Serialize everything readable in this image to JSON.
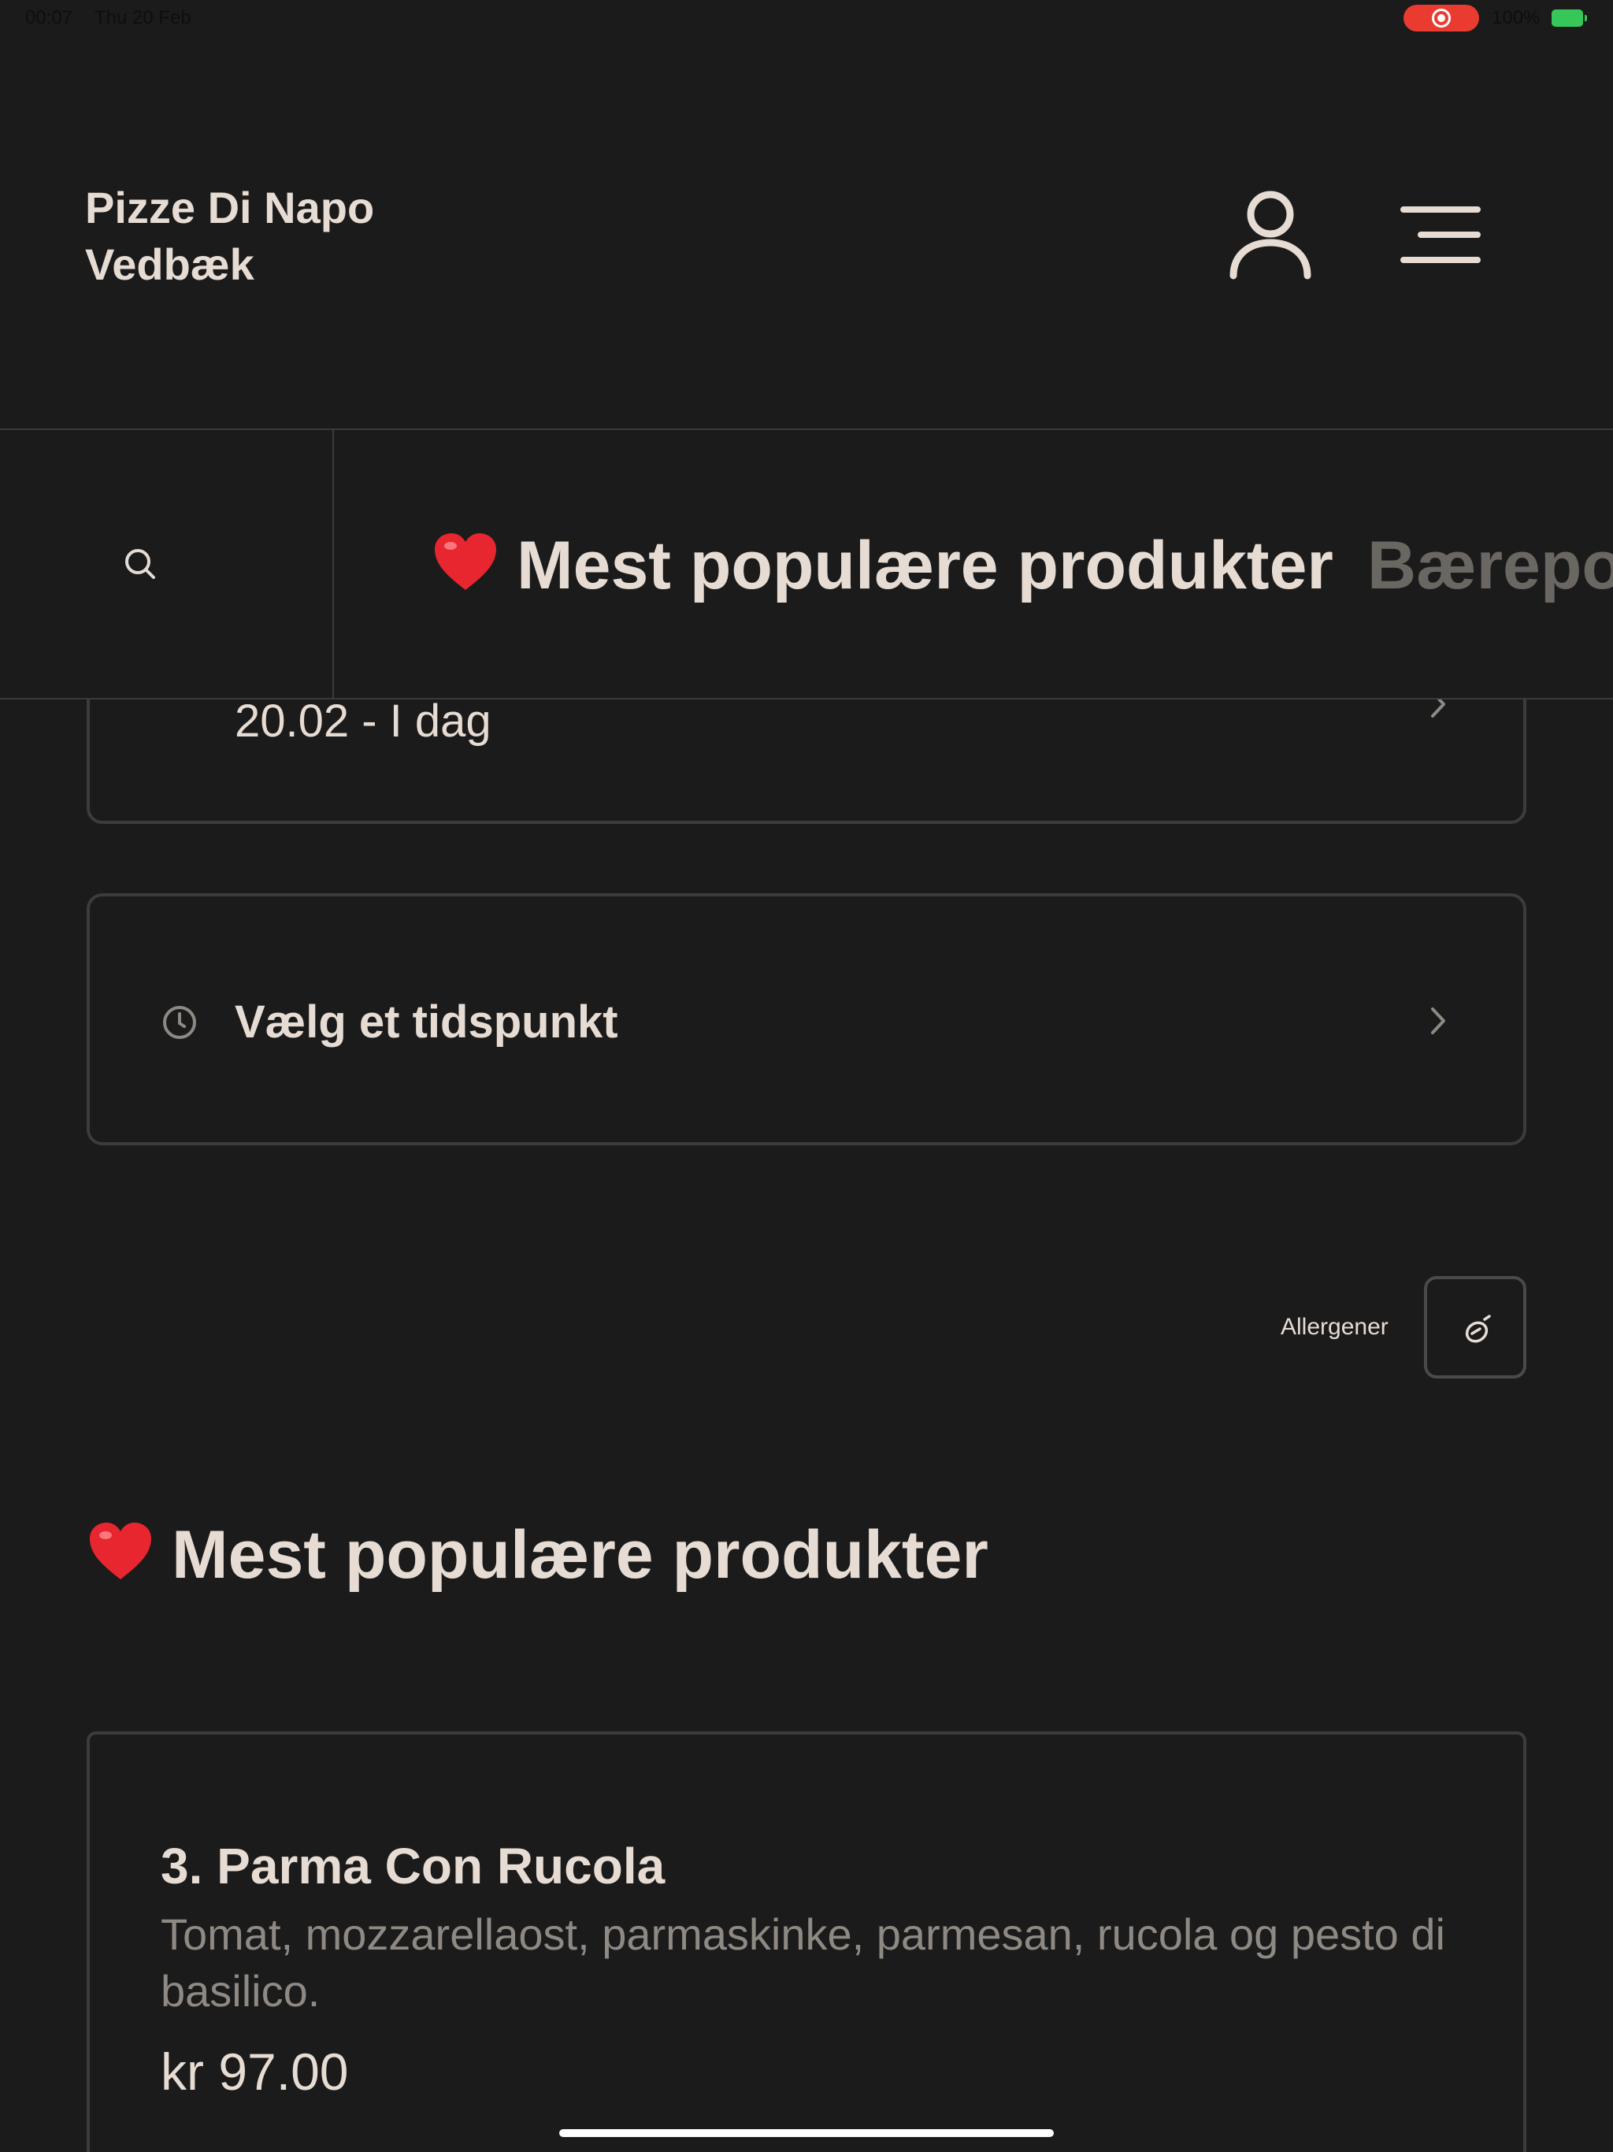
{
  "status_bar": {
    "time": "00:07",
    "date": "Thu 20 Feb",
    "battery": "100%"
  },
  "header": {
    "restaurant_line1": "Pizze Di Napo",
    "restaurant_line2": "Vedbæk"
  },
  "category_bar": {
    "items": [
      {
        "emoji": "❤️",
        "label": "Mest populære produkter"
      },
      {
        "label": "Bærepo"
      }
    ]
  },
  "date_selector": {
    "value": "20.02 - I dag"
  },
  "time_selector": {
    "label": "Vælg et tidspunkt"
  },
  "allergens": {
    "label": "Allergener"
  },
  "section": {
    "title": "Mest populære produkter"
  },
  "products": [
    {
      "name": "3. Parma Con Rucola",
      "description": "Tomat, mozzarellaost, parmaskinke, parmesan, rucola og pesto di basilico.",
      "price": "kr 97.00"
    }
  ],
  "colors": {
    "background": "#1b1b1b",
    "text": "#e6dcd3",
    "muted": "#8f8983",
    "border": "#3c3c3c",
    "recording": "#ea3b30",
    "battery": "#35c759"
  },
  "icons": {
    "account": "user-icon",
    "menu": "hamburger-menu-icon",
    "search": "search-icon",
    "time": "clock-icon",
    "allergen": "allergen-icon"
  }
}
